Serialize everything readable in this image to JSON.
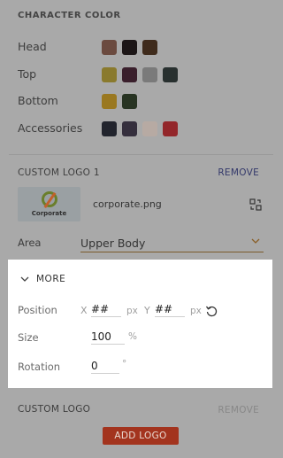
{
  "character_color": {
    "title": "CHARACTER COLOR",
    "rows": [
      {
        "label": "Head",
        "swatches": [
          "#6b4a3f",
          "#1c1617",
          "#3f2b1c"
        ]
      },
      {
        "label": "Top",
        "swatches": [
          "#8a7a2d",
          "#3a1f2c",
          "#7a7a7a",
          "#28302f"
        ]
      },
      {
        "label": "Bottom",
        "swatches": [
          "#9a7820",
          "#283423"
        ]
      },
      {
        "label": "Accessories",
        "swatches": [
          "#22242d",
          "#352f3d",
          "#b7aaa3",
          "#93262a"
        ]
      }
    ]
  },
  "custom_logo_1": {
    "title": "CUSTOM LOGO 1",
    "remove_label": "REMOVE",
    "logo_text": "Corporate",
    "filename": "corporate.png",
    "area_label": "Area",
    "area_value": "Upper Body"
  },
  "more": {
    "title": "MORE",
    "position_label": "Position",
    "x_label": "X",
    "x_value": "##",
    "y_label": "Y",
    "y_value": "##",
    "px_unit": "px",
    "size_label": "Size",
    "size_value": "100",
    "size_unit": "%",
    "rotation_label": "Rotation",
    "rotation_value": "0",
    "rotation_unit": "°"
  },
  "custom_logo": {
    "title": "CUSTOM LOGO",
    "remove_label": "REMOVE",
    "add_label": "ADD LOGO"
  },
  "colors": {
    "accent_button": "#a3341e",
    "remove_link": "#33386a",
    "overlay": "#a9a9a9"
  }
}
